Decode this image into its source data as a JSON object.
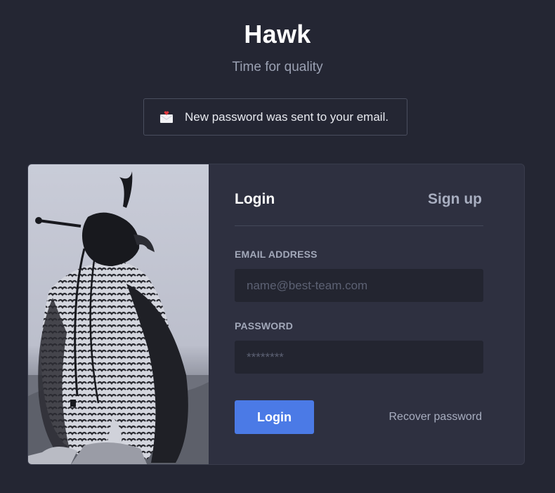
{
  "brand": {
    "title": "Hawk",
    "subtitle": "Time for quality"
  },
  "notice": {
    "icon": "envelope-icon",
    "text": "New password was sent to your email."
  },
  "card": {
    "image": "hawk-photo",
    "tabs": {
      "login": "Login",
      "signup": "Sign up"
    },
    "email": {
      "label": "EMAIL ADDRESS",
      "placeholder": "name@best-team.com",
      "value": ""
    },
    "password": {
      "label": "PASSWORD",
      "placeholder": "********",
      "value": ""
    },
    "submit_label": "Login",
    "recover_label": "Recover password"
  },
  "colors": {
    "background": "#242633",
    "card": "#2e3040",
    "input": "#232530",
    "accent": "#4b7ae6",
    "muted_text": "#a8aec0"
  }
}
